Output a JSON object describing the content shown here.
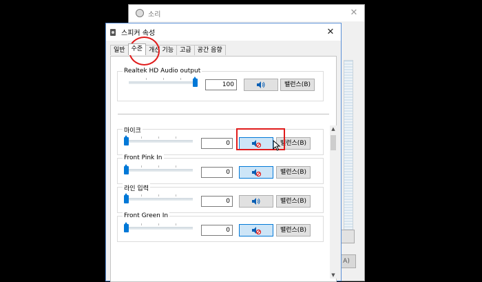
{
  "background_window": {
    "title": "소리",
    "footer_button_partial": "A)"
  },
  "window": {
    "title": "스피커 속성",
    "tabs": [
      {
        "label": "일반",
        "active": false
      },
      {
        "label": "수준",
        "active": true
      },
      {
        "label": "개선 기능",
        "active": false
      },
      {
        "label": "고급",
        "active": false
      },
      {
        "label": "공간 음향",
        "active": false
      }
    ]
  },
  "master": {
    "label": "Realtek HD Audio output",
    "value": "100",
    "level": 100,
    "muted": false,
    "balance_label": "밸런스(B)"
  },
  "channels": [
    {
      "label": "마이크",
      "value": "0",
      "level": 0,
      "muted": true,
      "balance_label": "밸런스(B)"
    },
    {
      "label": "Front Pink In",
      "value": "0",
      "level": 0,
      "muted": true,
      "balance_label": "밸런스(B)"
    },
    {
      "label": "라인 입력",
      "value": "0",
      "level": 0,
      "muted": false,
      "balance_label": "밸런스(B)"
    },
    {
      "label": "Front Green In",
      "value": "0",
      "level": 0,
      "muted": true,
      "balance_label": "밸런스(B)"
    }
  ],
  "colors": {
    "accent": "#0078d7",
    "annotation": "#e01b1b"
  },
  "icons": {
    "speaker": "speaker-icon",
    "speaker_muted": "speaker-muted-icon",
    "close": "close-icon"
  }
}
